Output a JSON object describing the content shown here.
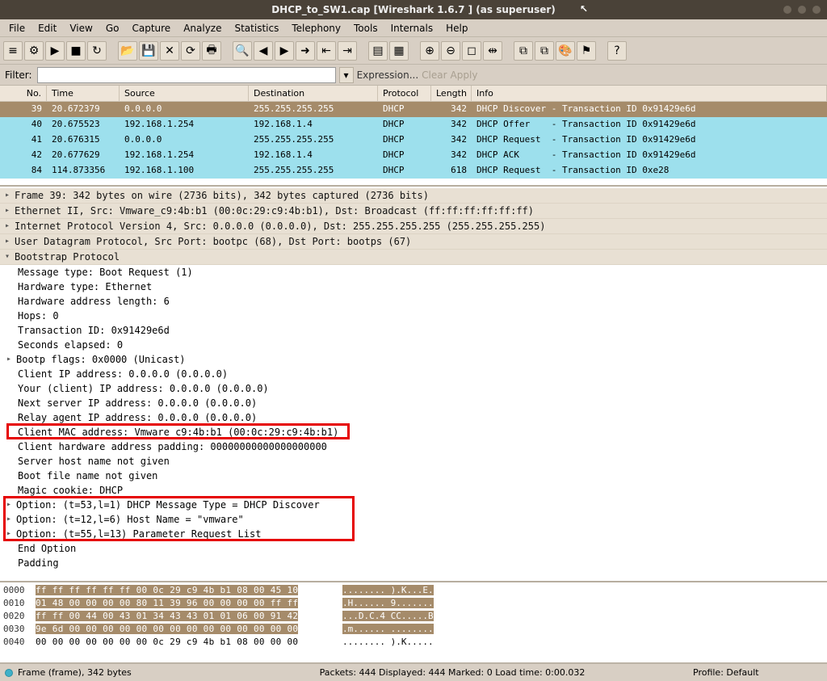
{
  "title": "DHCP_to_SW1.cap   [Wireshark 1.6.7 ] (as superuser)",
  "menu": [
    "File",
    "Edit",
    "View",
    "Go",
    "Capture",
    "Analyze",
    "Statistics",
    "Telephony",
    "Tools",
    "Internals",
    "Help"
  ],
  "filter": {
    "label": "Filter:",
    "value": "",
    "expression": "Expression...",
    "clear": "Clear",
    "apply": "Apply"
  },
  "columns": {
    "no": "No.",
    "time": "Time",
    "src": "Source",
    "dst": "Destination",
    "proto": "Protocol",
    "len": "Length",
    "info": "Info"
  },
  "packets": [
    {
      "no": "39",
      "time": "20.672379",
      "src": "0.0.0.0",
      "dst": "255.255.255.255",
      "proto": "DHCP",
      "len": "342",
      "info": "DHCP Discover - Transaction ID 0x91429e6d",
      "sel": true
    },
    {
      "no": "40",
      "time": "20.675523",
      "src": "192.168.1.254",
      "dst": "192.168.1.4",
      "proto": "DHCP",
      "len": "342",
      "info": "DHCP Offer    - Transaction ID 0x91429e6d",
      "sel": false
    },
    {
      "no": "41",
      "time": "20.676315",
      "src": "0.0.0.0",
      "dst": "255.255.255.255",
      "proto": "DHCP",
      "len": "342",
      "info": "DHCP Request  - Transaction ID 0x91429e6d",
      "sel": false
    },
    {
      "no": "42",
      "time": "20.677629",
      "src": "192.168.1.254",
      "dst": "192.168.1.4",
      "proto": "DHCP",
      "len": "342",
      "info": "DHCP ACK      - Transaction ID 0x91429e6d",
      "sel": false
    },
    {
      "no": "84",
      "time": "114.873356",
      "src": "192.168.1.100",
      "dst": "255.255.255.255",
      "proto": "DHCP",
      "len": "618",
      "info": "DHCP Request  - Transaction ID 0xe28",
      "sel": false
    }
  ],
  "tree": {
    "frame": "Frame 39: 342 bytes on wire (2736 bits), 342 bytes captured (2736 bits)",
    "eth": "Ethernet II, Src: Vmware_c9:4b:b1 (00:0c:29:c9:4b:b1), Dst: Broadcast (ff:ff:ff:ff:ff:ff)",
    "ip": "Internet Protocol Version 4, Src: 0.0.0.0 (0.0.0.0), Dst: 255.255.255.255 (255.255.255.255)",
    "udp": "User Datagram Protocol, Src Port: bootpc (68), Dst Port: bootps (67)",
    "bootp": "Bootstrap Protocol",
    "msgtype": "Message type: Boot Request (1)",
    "hwtype": "Hardware type: Ethernet",
    "hwlen": "Hardware address length: 6",
    "hops": "Hops: 0",
    "txid": "Transaction ID: 0x91429e6d",
    "secs": "Seconds elapsed: 0",
    "flags": "Bootp flags: 0x0000 (Unicast)",
    "cip": "Client IP address: 0.0.0.0 (0.0.0.0)",
    "yip": "Your (client) IP address: 0.0.0.0 (0.0.0.0)",
    "nip": "Next server IP address: 0.0.0.0 (0.0.0.0)",
    "rip": "Relay agent IP address: 0.0.0.0 (0.0.0.0)",
    "cmac": "Client MAC address: Vmware_c9:4b:b1 (00:0c:29:c9:4b:b1)",
    "chwpad": "Client hardware address padding: 00000000000000000000",
    "shn": "Server host name not given",
    "bfn": "Boot file name not given",
    "magic": "Magic cookie: DHCP",
    "opt53": "Option: (t=53,l=1) DHCP Message Type = DHCP Discover",
    "opt12": "Option: (t=12,l=6) Host Name = \"vmware\"",
    "opt55": "Option: (t=55,l=13) Parameter Request List",
    "endopt": "End Option",
    "pad": "Padding"
  },
  "hex": [
    {
      "off": "0000",
      "b": "ff ff ff ff ff ff 00 0c  29 c9 4b b1 08 00 45 10",
      "a": "........ ).K...E."
    },
    {
      "off": "0010",
      "b": "01 48 00 00 00 00 80 11  39 96 00 00 00 00 ff ff",
      "a": ".H...... 9......."
    },
    {
      "off": "0020",
      "b": "ff ff 00 44 00 43 01 34  43 43 01 01 06 00 91 42",
      "a": "...D.C.4 CC.....B"
    },
    {
      "off": "0030",
      "b": "9e 6d 00 00 00 00 00 00  00 00 00 00 00 00 00 00",
      "a": ".m...... ........"
    },
    {
      "off": "0040",
      "b": "00 00 00 00 00 00 00 0c  29 c9 4b b1 08 00 00 00",
      "a": "........ ).K....."
    }
  ],
  "status": {
    "left": "Frame (frame), 342 bytes",
    "center": "Packets: 444 Displayed: 444 Marked: 0 Load time: 0:00.032",
    "right": "Profile: Default"
  }
}
